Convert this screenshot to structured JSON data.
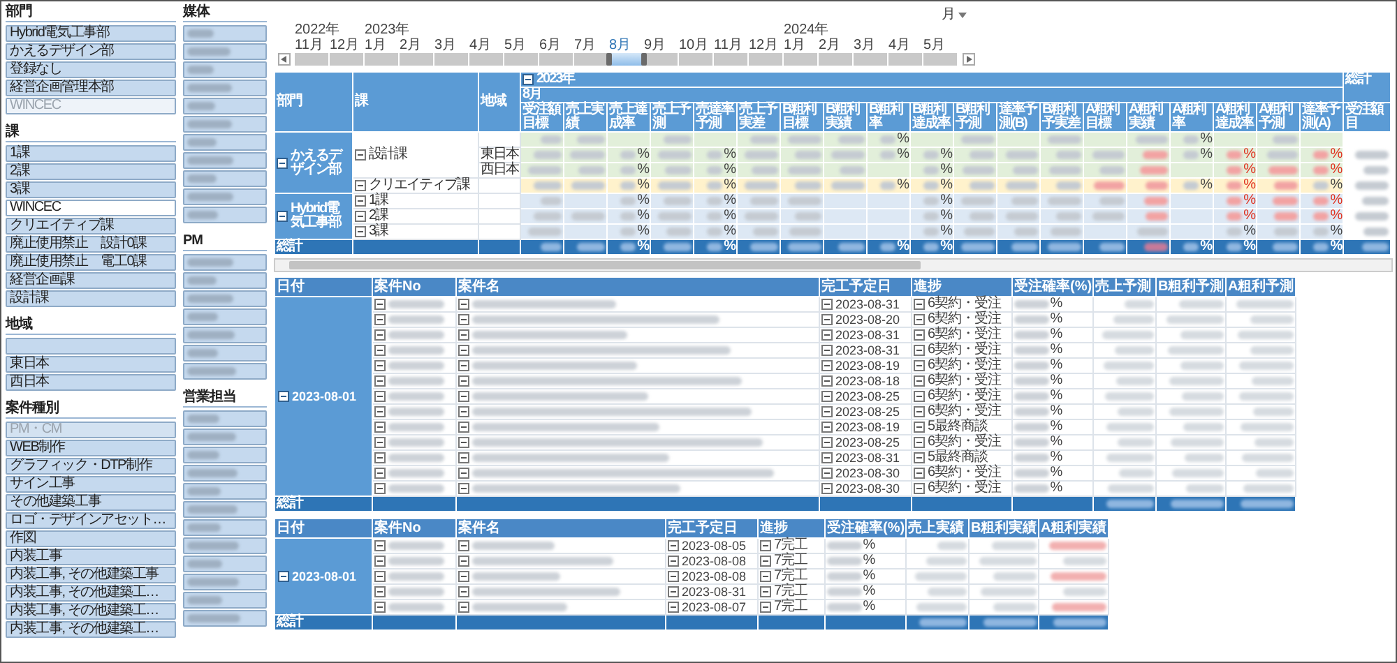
{
  "slicer_columns": [
    {
      "slicers": [
        {
          "title": "部門",
          "items": [
            {
              "kind": "text",
              "label": "Hybrid電気工事部",
              "selected": true,
              "disabled": false
            },
            {
              "kind": "text",
              "label": "かえるデザイン部",
              "selected": true,
              "disabled": false
            },
            {
              "kind": "text",
              "label": "登録なし",
              "selected": true,
              "disabled": false
            },
            {
              "kind": "text",
              "label": "経営企画管理本部",
              "selected": true,
              "disabled": false
            },
            {
              "kind": "text",
              "label": "WINCEC",
              "selected": false,
              "disabled": true
            }
          ]
        },
        {
          "title": "課",
          "items": [
            {
              "kind": "text",
              "label": "1課",
              "selected": true,
              "disabled": false
            },
            {
              "kind": "text",
              "label": "2課",
              "selected": true,
              "disabled": false
            },
            {
              "kind": "text",
              "label": "3課",
              "selected": true,
              "disabled": false
            },
            {
              "kind": "text",
              "label": "WINCEC",
              "selected": false,
              "disabled": false
            },
            {
              "kind": "text",
              "label": "クリエイティブ課",
              "selected": true,
              "disabled": false
            },
            {
              "kind": "text",
              "label": "廃止使用禁止　設計0課",
              "selected": true,
              "disabled": false
            },
            {
              "kind": "text",
              "label": "廃止使用禁止　電工0課",
              "selected": true,
              "disabled": false
            },
            {
              "kind": "text",
              "label": "経営企画課",
              "selected": true,
              "disabled": false
            },
            {
              "kind": "text",
              "label": "設計課",
              "selected": true,
              "disabled": false
            }
          ]
        },
        {
          "title": "地域",
          "items": [
            {
              "kind": "blank",
              "selected": true,
              "disabled": false
            },
            {
              "kind": "text",
              "label": "東日本",
              "selected": true,
              "disabled": false
            },
            {
              "kind": "text",
              "label": "西日本",
              "selected": true,
              "disabled": false
            }
          ]
        },
        {
          "title": "案件種別",
          "items": [
            {
              "kind": "text",
              "label": "PM・CM",
              "selected": true,
              "disabled": true
            },
            {
              "kind": "text",
              "label": "WEB制作",
              "selected": true,
              "disabled": false
            },
            {
              "kind": "text",
              "label": "グラフィック・DTP制作",
              "selected": true,
              "disabled": false
            },
            {
              "kind": "text",
              "label": "サイン工事",
              "selected": true,
              "disabled": false
            },
            {
              "kind": "text",
              "label": "その他建築工事",
              "selected": true,
              "disabled": false
            },
            {
              "kind": "text",
              "label": "ロゴ・デザインアセット…",
              "selected": true,
              "disabled": false
            },
            {
              "kind": "text",
              "label": "作図",
              "selected": true,
              "disabled": false
            },
            {
              "kind": "text",
              "label": "内装工事",
              "selected": true,
              "disabled": false
            },
            {
              "kind": "text",
              "label": "内装工事, その他建築工事",
              "selected": true,
              "disabled": false
            },
            {
              "kind": "text",
              "label": "内装工事, その他建築工…",
              "selected": true,
              "disabled": false
            },
            {
              "kind": "text",
              "label": "内装工事, その他建築工…",
              "selected": true,
              "disabled": false
            },
            {
              "kind": "text",
              "label": "内装工事, その他建築工…",
              "selected": true,
              "disabled": false
            }
          ]
        }
      ]
    },
    {
      "slicers": [
        {
          "title": "媒体",
          "items": [
            {
              "kind": "blurred",
              "selected": true,
              "disabled": false
            },
            {
              "kind": "blurred",
              "selected": true,
              "disabled": false
            },
            {
              "kind": "blurred",
              "selected": true,
              "disabled": false
            },
            {
              "kind": "blurred",
              "selected": true,
              "disabled": false
            },
            {
              "kind": "blurred",
              "selected": true,
              "disabled": false
            },
            {
              "kind": "blurred",
              "selected": true,
              "disabled": false
            },
            {
              "kind": "blurred",
              "selected": true,
              "disabled": false
            },
            {
              "kind": "blurred",
              "selected": true,
              "disabled": false
            },
            {
              "kind": "blurred",
              "selected": true,
              "disabled": false
            },
            {
              "kind": "blurred",
              "selected": true,
              "disabled": false
            },
            {
              "kind": "blurred",
              "selected": true,
              "disabled": false
            }
          ]
        },
        {
          "title": "PM",
          "items": [
            {
              "kind": "blurred",
              "selected": true,
              "disabled": false
            },
            {
              "kind": "blurred",
              "selected": true,
              "disabled": false
            },
            {
              "kind": "blurred",
              "selected": true,
              "disabled": false
            },
            {
              "kind": "blurred",
              "selected": true,
              "disabled": false
            },
            {
              "kind": "blurred",
              "selected": true,
              "disabled": false
            },
            {
              "kind": "blurred",
              "selected": true,
              "disabled": false
            },
            {
              "kind": "blurred",
              "selected": true,
              "disabled": false
            }
          ]
        },
        {
          "title": "営業担当",
          "items": [
            {
              "kind": "blurred",
              "selected": true,
              "disabled": false
            },
            {
              "kind": "blurred",
              "selected": true,
              "disabled": false
            },
            {
              "kind": "blurred",
              "selected": true,
              "disabled": false
            },
            {
              "kind": "blurred",
              "selected": true,
              "disabled": false
            },
            {
              "kind": "blurred",
              "selected": true,
              "disabled": false
            },
            {
              "kind": "blurred",
              "selected": true,
              "disabled": false
            },
            {
              "kind": "blurred",
              "selected": true,
              "disabled": false
            },
            {
              "kind": "blurred",
              "selected": true,
              "disabled": false
            },
            {
              "kind": "blurred",
              "selected": true,
              "disabled": false
            },
            {
              "kind": "blurred",
              "selected": true,
              "disabled": false
            },
            {
              "kind": "blurred",
              "selected": true,
              "disabled": false
            },
            {
              "kind": "blurred",
              "selected": true,
              "disabled": false
            }
          ]
        }
      ]
    }
  ],
  "timeline": {
    "unit": "月",
    "years": [
      {
        "label": "2022年",
        "months": [
          {
            "label": "11月",
            "selected": false
          },
          {
            "label": "12月",
            "selected": false
          }
        ]
      },
      {
        "label": "2023年",
        "months": [
          {
            "label": "1月",
            "selected": false
          },
          {
            "label": "2月",
            "selected": false
          },
          {
            "label": "3月",
            "selected": false
          },
          {
            "label": "4月",
            "selected": false
          },
          {
            "label": "5月",
            "selected": false
          },
          {
            "label": "6月",
            "selected": false
          },
          {
            "label": "7月",
            "selected": false
          },
          {
            "label": "8月",
            "selected": true
          },
          {
            "label": "9月",
            "selected": false
          },
          {
            "label": "10月",
            "selected": false
          },
          {
            "label": "11月",
            "selected": false
          },
          {
            "label": "12月",
            "selected": false
          }
        ]
      },
      {
        "label": "2024年",
        "months": [
          {
            "label": "1月",
            "selected": false
          },
          {
            "label": "2月",
            "selected": false
          },
          {
            "label": "3月",
            "selected": false
          },
          {
            "label": "4月",
            "selected": false
          },
          {
            "label": "5月",
            "selected": false
          }
        ]
      }
    ]
  },
  "pivot": {
    "row_headers": [
      "部門",
      "課",
      "地域"
    ],
    "year": "2023年",
    "month": "8月",
    "grand_total_header": "総計",
    "grand_total_column": "受注額目",
    "columns": [
      "受注額目標",
      "売上実績",
      "売上達成率",
      "売上予測",
      "売達率予測",
      "売上予実差",
      "B粗利目標",
      "B粗利実績",
      "B粗利率",
      "B粗利達成率",
      "B粗利予測",
      "達率予測(B)",
      "B粗利予実差",
      "A粗利目標",
      "A粗利実績",
      "A粗利率",
      "A粗利達成率",
      "A粗利予測",
      "達率予測(A)"
    ],
    "departments": [
      {
        "label": "かえるデザイン部",
        "sections": [
          {
            "label": "設計課",
            "color": "#e2efda",
            "rows": [
              {
                "cells": [
                  {
                    "kind": "blur"
                  },
                  {
                    "kind": "blur"
                  },
                  {
                    "kind": "empty"
                  },
                  {
                    "kind": "blur"
                  },
                  {
                    "kind": "empty"
                  },
                  {
                    "kind": "blur"
                  },
                  {
                    "kind": "blur"
                  },
                  {
                    "kind": "blur"
                  },
                  {
                    "kind": "pct",
                    "text": "%"
                  },
                  {
                    "kind": "empty"
                  },
                  {
                    "kind": "blur"
                  },
                  {
                    "kind": "empty"
                  },
                  {
                    "kind": "blur"
                  },
                  {
                    "kind": "empty"
                  },
                  {
                    "kind": "blur"
                  },
                  {
                    "kind": "pct",
                    "text": "%"
                  },
                  {
                    "kind": "empty"
                  },
                  {
                    "kind": "blur"
                  },
                  {
                    "kind": "empty"
                  },
                  {
                    "kind": "empty"
                  }
                ]
              },
              {
                "region": "東日本",
                "cells": [
                  {
                    "kind": "blur"
                  },
                  {
                    "kind": "blur"
                  },
                  {
                    "kind": "pct",
                    "text": "%"
                  },
                  {
                    "kind": "blur"
                  },
                  {
                    "kind": "pct",
                    "text": "%"
                  },
                  {
                    "kind": "blur"
                  },
                  {
                    "kind": "blur"
                  },
                  {
                    "kind": "blur"
                  },
                  {
                    "kind": "pct",
                    "text": "%"
                  },
                  {
                    "kind": "pct",
                    "text": "%"
                  },
                  {
                    "kind": "blur"
                  },
                  {
                    "kind": "blur"
                  },
                  {
                    "kind": "blur"
                  },
                  {
                    "kind": "blur"
                  },
                  {
                    "kind": "neg"
                  },
                  {
                    "kind": "pct",
                    "text": "%"
                  },
                  {
                    "kind": "negpct",
                    "text": "%"
                  },
                  {
                    "kind": "blur"
                  },
                  {
                    "kind": "negpct",
                    "text": "%"
                  },
                  {
                    "kind": "blur"
                  }
                ]
              },
              {
                "region": "西日本",
                "cells": [
                  {
                    "kind": "blur"
                  },
                  {
                    "kind": "blur"
                  },
                  {
                    "kind": "pct",
                    "text": "%"
                  },
                  {
                    "kind": "blur"
                  },
                  {
                    "kind": "pct",
                    "text": "%"
                  },
                  {
                    "kind": "blur"
                  },
                  {
                    "kind": "blur"
                  },
                  {
                    "kind": "blur"
                  },
                  {
                    "kind": "empty"
                  },
                  {
                    "kind": "pct",
                    "text": "%"
                  },
                  {
                    "kind": "blur"
                  },
                  {
                    "kind": "blur"
                  },
                  {
                    "kind": "blur"
                  },
                  {
                    "kind": "blur"
                  },
                  {
                    "kind": "neg"
                  },
                  {
                    "kind": "empty"
                  },
                  {
                    "kind": "negpct",
                    "text": "%"
                  },
                  {
                    "kind": "neg"
                  },
                  {
                    "kind": "negpct",
                    "text": "%"
                  },
                  {
                    "kind": "blur"
                  }
                ]
              }
            ]
          },
          {
            "label": "クリエイティブ課",
            "color": "#fff2cc",
            "rows": [
              {
                "cells": [
                  {
                    "kind": "blur"
                  },
                  {
                    "kind": "blur"
                  },
                  {
                    "kind": "pct",
                    "text": "%"
                  },
                  {
                    "kind": "blur"
                  },
                  {
                    "kind": "pct",
                    "text": "%"
                  },
                  {
                    "kind": "blur"
                  },
                  {
                    "kind": "blur"
                  },
                  {
                    "kind": "blur"
                  },
                  {
                    "kind": "pct",
                    "text": "%"
                  },
                  {
                    "kind": "pct",
                    "text": "%"
                  },
                  {
                    "kind": "blur"
                  },
                  {
                    "kind": "blur"
                  },
                  {
                    "kind": "blur"
                  },
                  {
                    "kind": "neg"
                  },
                  {
                    "kind": "neg"
                  },
                  {
                    "kind": "pct",
                    "text": "%"
                  },
                  {
                    "kind": "negpct",
                    "text": "%"
                  },
                  {
                    "kind": "neg"
                  },
                  {
                    "kind": "pct",
                    "text": "%"
                  },
                  {
                    "kind": "blur"
                  }
                ]
              }
            ]
          }
        ]
      },
      {
        "label": "Hybrid電気工事部",
        "sections": [
          {
            "label": "1課",
            "color": "#dde8f4",
            "rows": [
              {
                "cells": [
                  {
                    "kind": "blur"
                  },
                  {
                    "kind": "empty"
                  },
                  {
                    "kind": "pct",
                    "text": "%"
                  },
                  {
                    "kind": "blur"
                  },
                  {
                    "kind": "pct",
                    "text": "%"
                  },
                  {
                    "kind": "blur"
                  },
                  {
                    "kind": "blur"
                  },
                  {
                    "kind": "empty"
                  },
                  {
                    "kind": "empty"
                  },
                  {
                    "kind": "pct",
                    "text": "%"
                  },
                  {
                    "kind": "blur"
                  },
                  {
                    "kind": "blur"
                  },
                  {
                    "kind": "blur"
                  },
                  {
                    "kind": "blur"
                  },
                  {
                    "kind": "neg"
                  },
                  {
                    "kind": "empty"
                  },
                  {
                    "kind": "negpct",
                    "text": "%"
                  },
                  {
                    "kind": "neg"
                  },
                  {
                    "kind": "negpct",
                    "text": "%"
                  },
                  {
                    "kind": "blur"
                  }
                ]
              }
            ]
          },
          {
            "label": "2課",
            "color": "#dde8f4",
            "rows": [
              {
                "cells": [
                  {
                    "kind": "blur"
                  },
                  {
                    "kind": "blur"
                  },
                  {
                    "kind": "pct",
                    "text": "%"
                  },
                  {
                    "kind": "blur"
                  },
                  {
                    "kind": "pct",
                    "text": "%"
                  },
                  {
                    "kind": "blur"
                  },
                  {
                    "kind": "blur"
                  },
                  {
                    "kind": "empty"
                  },
                  {
                    "kind": "empty"
                  },
                  {
                    "kind": "pct",
                    "text": "%"
                  },
                  {
                    "kind": "blur"
                  },
                  {
                    "kind": "blur"
                  },
                  {
                    "kind": "blur"
                  },
                  {
                    "kind": "blur"
                  },
                  {
                    "kind": "neg"
                  },
                  {
                    "kind": "empty"
                  },
                  {
                    "kind": "negpct",
                    "text": "%"
                  },
                  {
                    "kind": "neg"
                  },
                  {
                    "kind": "negpct",
                    "text": "%"
                  },
                  {
                    "kind": "blur"
                  }
                ]
              }
            ]
          },
          {
            "label": "3課",
            "color": "#dde8f4",
            "rows": [
              {
                "cells": [
                  {
                    "kind": "blur"
                  },
                  {
                    "kind": "empty"
                  },
                  {
                    "kind": "pct",
                    "text": "%"
                  },
                  {
                    "kind": "blur"
                  },
                  {
                    "kind": "pct",
                    "text": "%"
                  },
                  {
                    "kind": "blur"
                  },
                  {
                    "kind": "blur"
                  },
                  {
                    "kind": "empty"
                  },
                  {
                    "kind": "empty"
                  },
                  {
                    "kind": "pct",
                    "text": "%"
                  },
                  {
                    "kind": "blur"
                  },
                  {
                    "kind": "blur"
                  },
                  {
                    "kind": "blur"
                  },
                  {
                    "kind": "empty"
                  },
                  {
                    "kind": "blur"
                  },
                  {
                    "kind": "empty"
                  },
                  {
                    "kind": "pct",
                    "text": "%"
                  },
                  {
                    "kind": "blur"
                  },
                  {
                    "kind": "pct",
                    "text": "%"
                  },
                  {
                    "kind": "blur"
                  }
                ]
              }
            ]
          }
        ]
      }
    ],
    "total": {
      "label": "総計",
      "cells": [
        {
          "kind": "blur"
        },
        {
          "kind": "blur"
        },
        {
          "kind": "pct",
          "text": "%"
        },
        {
          "kind": "blur"
        },
        {
          "kind": "pct",
          "text": "%"
        },
        {
          "kind": "blur"
        },
        {
          "kind": "blur"
        },
        {
          "kind": "blur"
        },
        {
          "kind": "pct",
          "text": "%"
        },
        {
          "kind": "pct",
          "text": "%"
        },
        {
          "kind": "blur"
        },
        {
          "kind": "blur"
        },
        {
          "kind": "blur"
        },
        {
          "kind": "blur"
        },
        {
          "kind": "neg"
        },
        {
          "kind": "pct",
          "text": "%"
        },
        {
          "kind": "pct",
          "text": "%"
        },
        {
          "kind": "blur"
        },
        {
          "kind": "pct",
          "text": "%"
        },
        {
          "kind": "blur"
        }
      ]
    }
  },
  "detail_tables": [
    {
      "columns": [
        "日付",
        "案件No",
        "案件名",
        "完工予定日",
        "進捗",
        "受注確率(%)",
        "売上予測",
        "B粗利予測",
        "A粗利予測"
      ],
      "date": "2023-08-01",
      "total_label": "総計",
      "rows": [
        {
          "due": "2023-08-31",
          "progress": "6契約・受注",
          "rate": "%"
        },
        {
          "due": "2023-08-20",
          "progress": "6契約・受注",
          "rate": "%"
        },
        {
          "due": "2023-08-31",
          "progress": "6契約・受注",
          "rate": "%"
        },
        {
          "due": "2023-08-31",
          "progress": "6契約・受注",
          "rate": "%"
        },
        {
          "due": "2023-08-19",
          "progress": "6契約・受注",
          "rate": "%"
        },
        {
          "due": "2023-08-18",
          "progress": "6契約・受注",
          "rate": "%"
        },
        {
          "due": "2023-08-25",
          "progress": "6契約・受注",
          "rate": "%"
        },
        {
          "due": "2023-08-25",
          "progress": "6契約・受注",
          "rate": "%"
        },
        {
          "due": "2023-08-19",
          "progress": "5最終商談",
          "rate": "%"
        },
        {
          "due": "2023-08-25",
          "progress": "6契約・受注",
          "rate": "%"
        },
        {
          "due": "2023-08-31",
          "progress": "5最終商談",
          "rate": "%"
        },
        {
          "due": "2023-08-30",
          "progress": "6契約・受注",
          "rate": "%"
        },
        {
          "due": "2023-08-30",
          "progress": "6契約・受注",
          "rate": "%"
        }
      ]
    },
    {
      "columns": [
        "日付",
        "案件No",
        "案件名",
        "完工予定日",
        "進捗",
        "受注確率(%)",
        "売上実績",
        "B粗利実績",
        "A粗利実績"
      ],
      "date": "2023-08-01",
      "total_label": "総計",
      "rows": [
        {
          "due": "2023-08-05",
          "progress": "7完工",
          "rate": "%"
        },
        {
          "due": "2023-08-08",
          "progress": "7完工",
          "rate": "%"
        },
        {
          "due": "2023-08-08",
          "progress": "7完工",
          "rate": "%"
        },
        {
          "due": "2023-08-31",
          "progress": "7完工",
          "rate": "%"
        },
        {
          "due": "2023-08-07",
          "progress": "7完工",
          "rate": "%"
        }
      ]
    }
  ]
}
